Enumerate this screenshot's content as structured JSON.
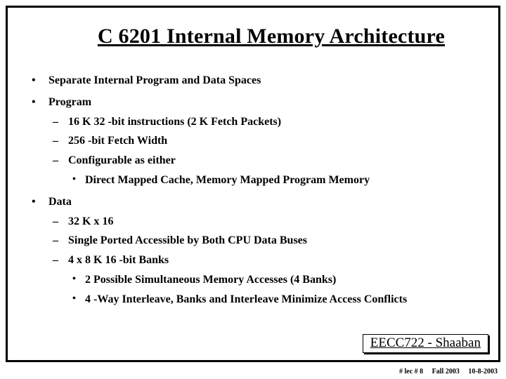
{
  "title": "C 6201 Internal Memory Architecture",
  "bullets": [
    {
      "text": "Separate Internal Program and Data Spaces"
    },
    {
      "text": "Program",
      "children": [
        {
          "text": "16 K 32 -bit instructions (2 K Fetch Packets)"
        },
        {
          "text": "256 -bit Fetch Width"
        },
        {
          "text": "Configurable as either",
          "children": [
            {
              "text": "Direct Mapped Cache, Memory Mapped Program Memory"
            }
          ]
        }
      ]
    },
    {
      "text": "Data",
      "children": [
        {
          "text": "32 K x 16"
        },
        {
          "text": "Single Ported Accessible by Both CPU Data Buses"
        },
        {
          "text": "4 x 8 K 16 -bit Banks",
          "children": [
            {
              "text": "2 Possible Simultaneous Memory Accesses (4 Banks)"
            },
            {
              "text": "4 -Way Interleave,  Banks and Interleave Minimize Access Conflicts"
            }
          ]
        }
      ]
    }
  ],
  "footer": {
    "course": "EECC722 - Shaaban",
    "slide": "#  lec # 8",
    "term": "Fall 2003",
    "date": "10-8-2003"
  }
}
